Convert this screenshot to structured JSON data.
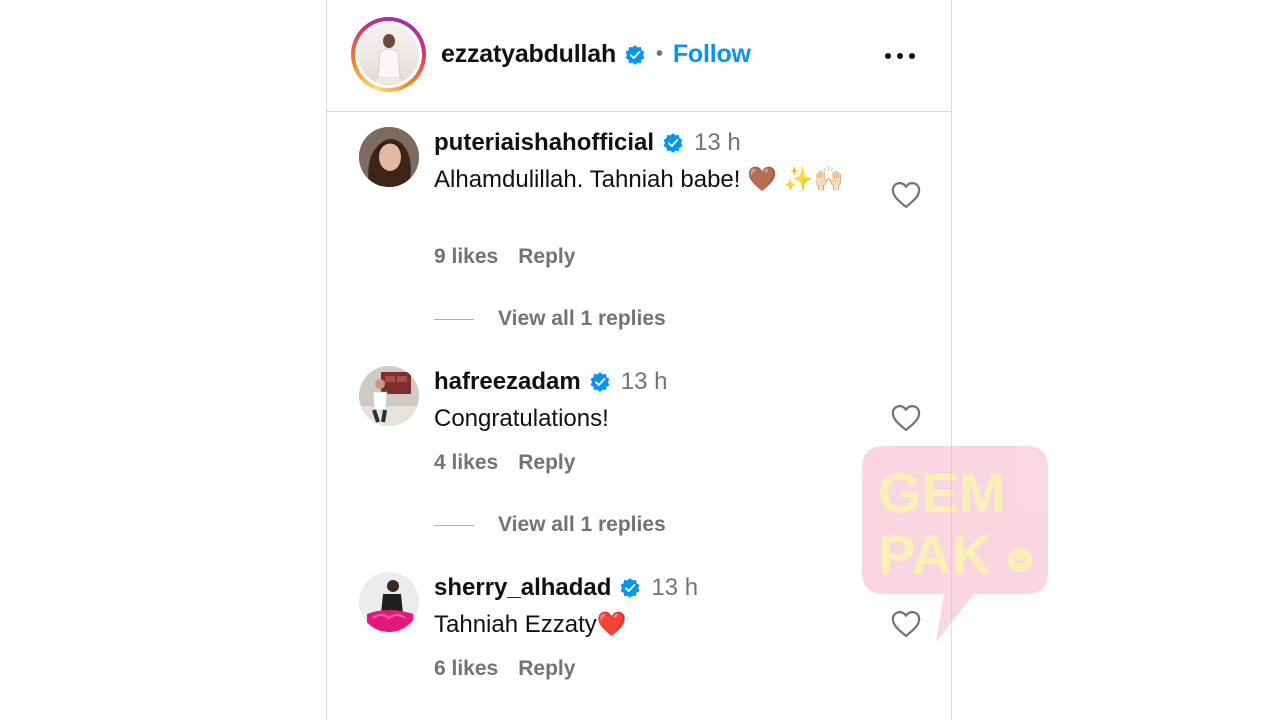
{
  "post": {
    "username": "ezzatyabdullah",
    "separator": "•",
    "follow_label": "Follow",
    "more_label": "More options"
  },
  "comments": [
    {
      "username": "puteriaishahofficial",
      "time": "13 h",
      "text": "Alhamdulillah. Tahniah babe! 🤎 ✨🙌🏻",
      "likes": "9 likes",
      "reply_label": "Reply",
      "view_replies": "View all 1 replies"
    },
    {
      "username": "hafreezadam",
      "time": "13 h",
      "text": "Congratulations!",
      "likes": "4 likes",
      "reply_label": "Reply",
      "view_replies": "View all 1 replies"
    },
    {
      "username": "sherry_alhadad",
      "time": "13 h",
      "text": "Tahniah Ezzaty❤️",
      "likes": "6 likes",
      "reply_label": "Reply"
    }
  ],
  "watermark": {
    "line1": "GEM",
    "line2": "PAK"
  },
  "colors": {
    "accent": "#0095f6",
    "verified": "#0095f6",
    "muted": "#737373",
    "watermark": "#f7b6c8"
  }
}
